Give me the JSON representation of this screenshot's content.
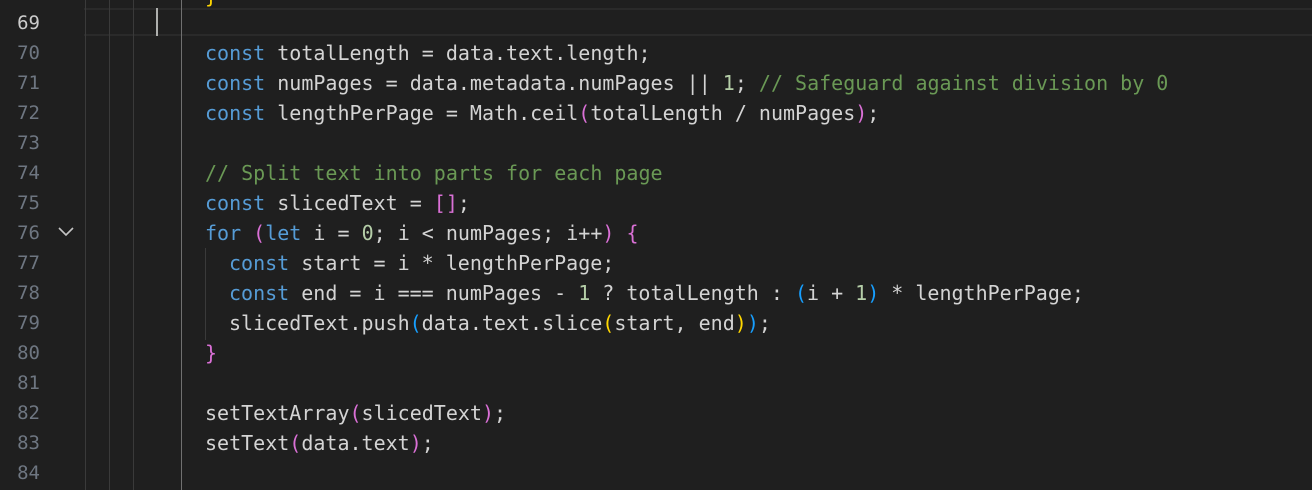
{
  "editor": {
    "active_line": "69",
    "line_numbers": [
      "69",
      "70",
      "71",
      "72",
      "73",
      "74",
      "75",
      "76",
      "77",
      "78",
      "79",
      "80",
      "81",
      "82",
      "83",
      "84"
    ],
    "fold_icon": "chevron-down-icon",
    "colors": {
      "background": "#1f1f1f",
      "keyword": "#569cd6",
      "comment": "#6a9955",
      "number": "#b5cea8",
      "bracket_level_1": "#ffd700",
      "bracket_level_2": "#da70d6",
      "bracket_level_3": "#179fff"
    },
    "top_partial": "}",
    "lines": [
      {
        "line": "70",
        "tokens": [
          [
            "kw",
            "const"
          ],
          [
            "op",
            " totalLength = data.text.length;"
          ]
        ]
      },
      {
        "line": "71",
        "tokens": [
          [
            "kw",
            "const"
          ],
          [
            "op",
            " numPages = data.metadata.numPages || "
          ],
          [
            "num",
            "1"
          ],
          [
            "op",
            "; "
          ],
          [
            "cm",
            "// Safeguard against division by 0"
          ]
        ]
      },
      {
        "line": "72",
        "tokens": [
          [
            "kw",
            "const"
          ],
          [
            "op",
            " lengthPerPage = Math.ceil"
          ],
          [
            "b2",
            "("
          ],
          [
            "op",
            "totalLength / numPages"
          ],
          [
            "b2",
            ")"
          ],
          [
            "op",
            ";"
          ]
        ]
      },
      {
        "line": "74",
        "tokens": [
          [
            "cm",
            "// Split text into parts for each page"
          ]
        ]
      },
      {
        "line": "75",
        "tokens": [
          [
            "kw",
            "const"
          ],
          [
            "op",
            " slicedText = "
          ],
          [
            "b2",
            "[]"
          ],
          [
            "op",
            ";"
          ]
        ]
      },
      {
        "line": "76",
        "tokens": [
          [
            "kw",
            "for"
          ],
          [
            "op",
            " "
          ],
          [
            "b2",
            "("
          ],
          [
            "kw",
            "let"
          ],
          [
            "op",
            " i = "
          ],
          [
            "num",
            "0"
          ],
          [
            "op",
            "; i < numPages; i++"
          ],
          [
            "b2",
            ")"
          ],
          [
            "op",
            " "
          ],
          [
            "b2",
            "{"
          ]
        ]
      },
      {
        "line": "77",
        "tokens": [
          [
            "kw",
            "const"
          ],
          [
            "op",
            " start = i * lengthPerPage;"
          ]
        ]
      },
      {
        "line": "78",
        "tokens": [
          [
            "kw",
            "const"
          ],
          [
            "op",
            " end = i === numPages - "
          ],
          [
            "num",
            "1"
          ],
          [
            "op",
            " ? totalLength : "
          ],
          [
            "b3",
            "("
          ],
          [
            "op",
            "i + "
          ],
          [
            "num",
            "1"
          ],
          [
            "b3",
            ")"
          ],
          [
            "op",
            " * lengthPerPage;"
          ]
        ]
      },
      {
        "line": "79",
        "tokens": [
          [
            "op",
            "slicedText.push"
          ],
          [
            "b3",
            "("
          ],
          [
            "op",
            "data.text.slice"
          ],
          [
            "b1",
            "("
          ],
          [
            "op",
            "start, end"
          ],
          [
            "b1",
            ")"
          ],
          [
            "b3",
            ")"
          ],
          [
            "op",
            ";"
          ]
        ]
      },
      {
        "line": "80",
        "tokens": [
          [
            "b2",
            "}"
          ]
        ]
      },
      {
        "line": "82",
        "tokens": [
          [
            "op",
            "setTextArray"
          ],
          [
            "b2",
            "("
          ],
          [
            "op",
            "slicedText"
          ],
          [
            "b2",
            ")"
          ],
          [
            "op",
            ";"
          ]
        ]
      },
      {
        "line": "83",
        "tokens": [
          [
            "op",
            "setText"
          ],
          [
            "b2",
            "("
          ],
          [
            "op",
            "data.text"
          ],
          [
            "b2",
            ")"
          ],
          [
            "op",
            ";"
          ]
        ]
      }
    ]
  }
}
